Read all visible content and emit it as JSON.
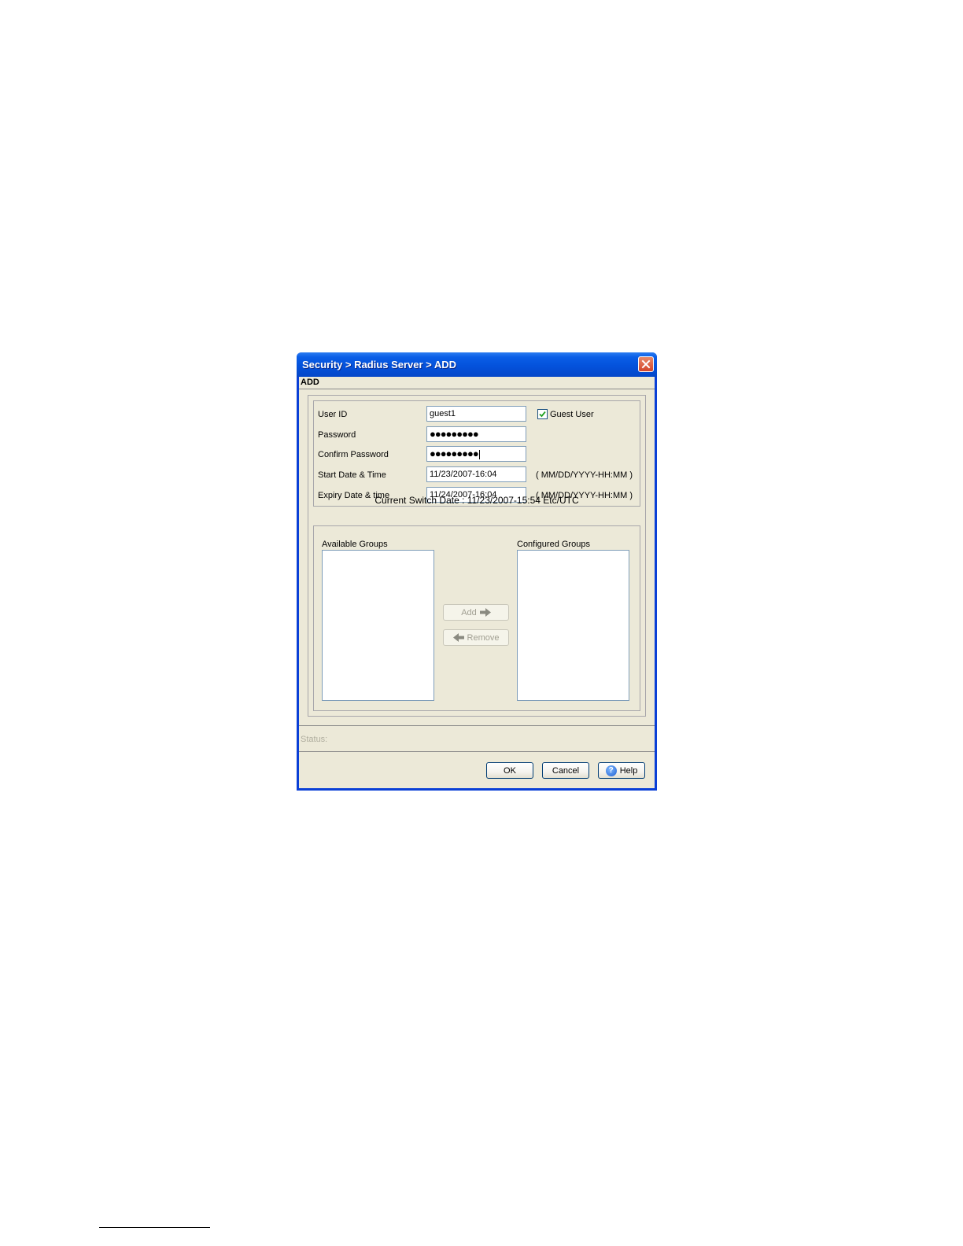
{
  "window": {
    "title": "Security > Radius Server > ADD",
    "heading": "ADD"
  },
  "form": {
    "user_id_label": "User ID",
    "user_id_value": "guest1",
    "guest_user_label": "Guest User",
    "guest_user_checked": true,
    "password_label": "Password",
    "password_value": "●●●●●●●●●",
    "confirm_password_label": "Confirm Password",
    "confirm_password_value": "●●●●●●●●●",
    "start_label": "Start Date & Time",
    "start_value": "11/23/2007-16:04",
    "start_hint": "( MM/DD/YYYY-HH:MM )",
    "expiry_label": "Expiry Date & time",
    "expiry_value": "11/24/2007-16:04",
    "expiry_hint": "( MM/DD/YYYY-HH:MM )"
  },
  "switch_date": "Current Switch Date : 11/23/2007-15:54  Etc/UTC",
  "groups": {
    "available_label": "Available Groups",
    "configured_label": "Configured Groups",
    "available_items": [],
    "configured_items": [],
    "add_label": "Add",
    "remove_label": "Remove"
  },
  "status_label": "Status:",
  "buttons": {
    "ok_label": "OK",
    "cancel_label": "Cancel",
    "help_label": "Help"
  },
  "icons": {
    "close": "close-icon",
    "check": "check-icon",
    "add_arrow": "arrow-right-icon",
    "remove_arrow": "arrow-left-icon",
    "help": "help-icon"
  },
  "colors": {
    "titlebar": "#0452dc",
    "client_bg": "#ece9d8",
    "close_button": "#d2452a",
    "button_border": "#003c74"
  }
}
